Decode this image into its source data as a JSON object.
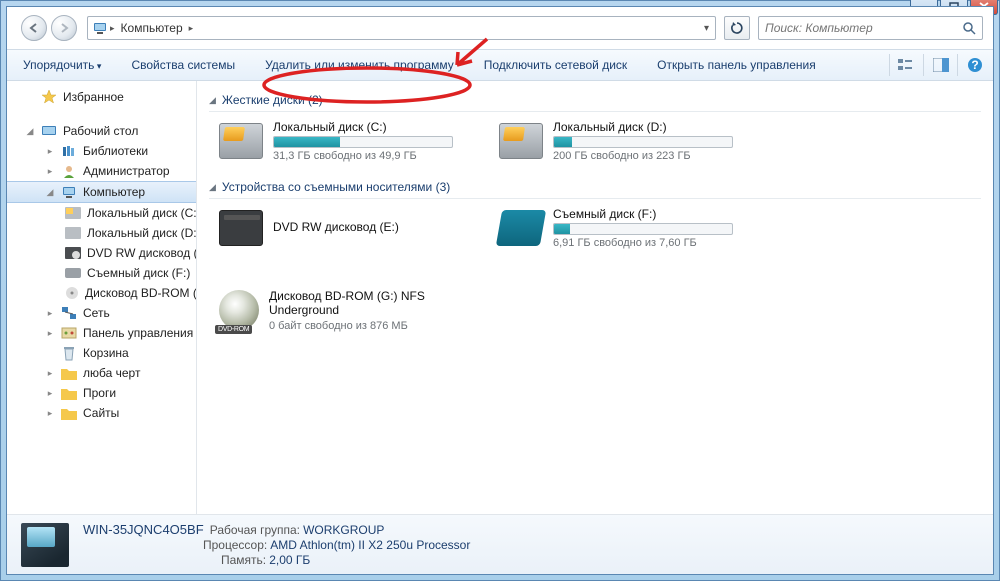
{
  "window": {
    "address_icon_label": "Компьютер",
    "address": [
      "Компьютер"
    ],
    "search_placeholder": "Поиск: Компьютер"
  },
  "toolbar": {
    "organize": "Упорядочить",
    "system_props": "Свойства системы",
    "uninstall": "Удалить или изменить программу",
    "map_drive": "Подключить сетевой диск",
    "control_panel": "Открыть панель управления"
  },
  "sidebar": {
    "favorites": "Избранное",
    "desktop": "Рабочий стол",
    "libraries": "Библиотеки",
    "admin": "Администратор",
    "computer": "Компьютер",
    "drives": [
      "Локальный диск (C:)",
      "Локальный диск (D:)",
      "DVD RW дисковод (E:)",
      "Съемный диск (F:)",
      "Дисковод BD-ROM (G:)"
    ],
    "network": "Сеть",
    "control": "Панель управления",
    "recycle": "Корзина",
    "user1": "люба черт",
    "user2": "Проги",
    "user3": "Сайты"
  },
  "content": {
    "hdd_group": "Жесткие диски (2)",
    "removable_group": "Устройства со съемными носителями (3)",
    "drives": {
      "c": {
        "name": "Локальный диск (C:)",
        "sub": "31,3 ГБ свободно из 49,9 ГБ",
        "pct": 37
      },
      "d": {
        "name": "Локальный диск (D:)",
        "sub": "200 ГБ свободно из 223 ГБ",
        "pct": 10
      },
      "dvd": {
        "name": "DVD RW дисковод (E:)"
      },
      "f": {
        "name": "Съемный диск (F:)",
        "sub": "6,91 ГБ свободно из 7,60 ГБ",
        "pct": 9
      },
      "bd": {
        "name": "Дисковод BD-ROM (G:) NFS Underground",
        "sub": "0 байт свободно из 876 МБ"
      }
    }
  },
  "details": {
    "name": "WIN-35JQNC4O5BF",
    "workgroup_label": "Рабочая группа:",
    "workgroup": "WORKGROUP",
    "cpu_label": "Процессор:",
    "cpu": "AMD Athlon(tm) II X2 250u Processor",
    "mem_label": "Память:",
    "mem": "2,00 ГБ"
  }
}
